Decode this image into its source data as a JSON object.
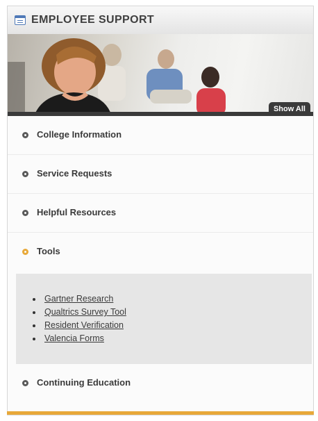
{
  "header": {
    "title": "EMPLOYEE SUPPORT",
    "icon": "window-icon"
  },
  "banner": {
    "show_all_label": "Show All"
  },
  "menu": {
    "items": [
      {
        "label": "College Information",
        "active": false
      },
      {
        "label": "Service Requests",
        "active": false
      },
      {
        "label": "Helpful Resources",
        "active": false
      },
      {
        "label": "Tools",
        "active": true
      }
    ],
    "tools_links": [
      "Gartner Research",
      "Qualtrics Survey Tool",
      "Resident Verification",
      "Valencia Forms"
    ],
    "last_item": {
      "label": "Continuing Education",
      "active": false
    }
  },
  "colors": {
    "accent": "#e8a93a",
    "dark_bar": "#3a3a3a",
    "submenu_bg": "#e6e6e6"
  }
}
